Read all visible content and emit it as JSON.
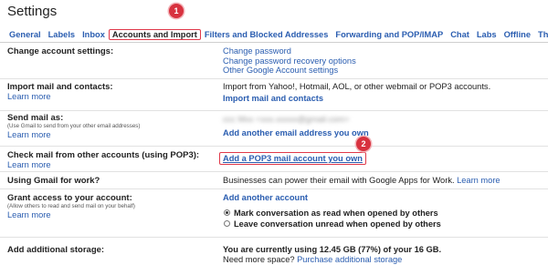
{
  "page_title": "Settings",
  "tabs": [
    {
      "label": "General"
    },
    {
      "label": "Labels"
    },
    {
      "label": "Inbox"
    },
    {
      "label": "Accounts and Import"
    },
    {
      "label": "Filters and Blocked Addresses"
    },
    {
      "label": "Forwarding and POP/IMAP"
    },
    {
      "label": "Chat"
    },
    {
      "label": "Labs"
    },
    {
      "label": "Offline"
    },
    {
      "label": "Themes"
    }
  ],
  "markers": {
    "one": "1",
    "two": "2"
  },
  "rows": {
    "change_account": {
      "title": "Change account settings:",
      "links": [
        "Change password",
        "Change password recovery options",
        "Other Google Account settings"
      ]
    },
    "import_mail": {
      "title": "Import mail and contacts:",
      "learn_more": "Learn more",
      "description": "Import from Yahoo!, Hotmail, AOL, or other webmail or POP3 accounts.",
      "action": "Import mail and contacts"
    },
    "send_mail": {
      "title": "Send mail as:",
      "note": "(Use Gmail to send from your other email addresses)",
      "learn_more": "Learn more",
      "address": "ccc Mxx <xxx.xxxxx@gmail.com>",
      "action": "Add another email address you own"
    },
    "check_mail": {
      "title": "Check mail from other accounts (using POP3):",
      "learn_more": "Learn more",
      "action": "Add a POP3 mail account you own"
    },
    "work": {
      "title": "Using Gmail for work?",
      "description": "Businesses can power their email with Google Apps for Work.",
      "learn_more": "Learn more"
    },
    "grant_access": {
      "title": "Grant access to your account:",
      "note": "(Allow others to read and send mail on your behalf)",
      "learn_more": "Learn more",
      "action": "Add another account",
      "option_read": "Mark conversation as read when opened by others",
      "option_unread": "Leave conversation unread when opened by others"
    },
    "storage": {
      "title": "Add additional storage:",
      "usage": "You are currently using 12.45 GB (77%) of your 16 GB.",
      "need_more": "Need more space?",
      "purchase": "Purchase additional storage"
    }
  }
}
